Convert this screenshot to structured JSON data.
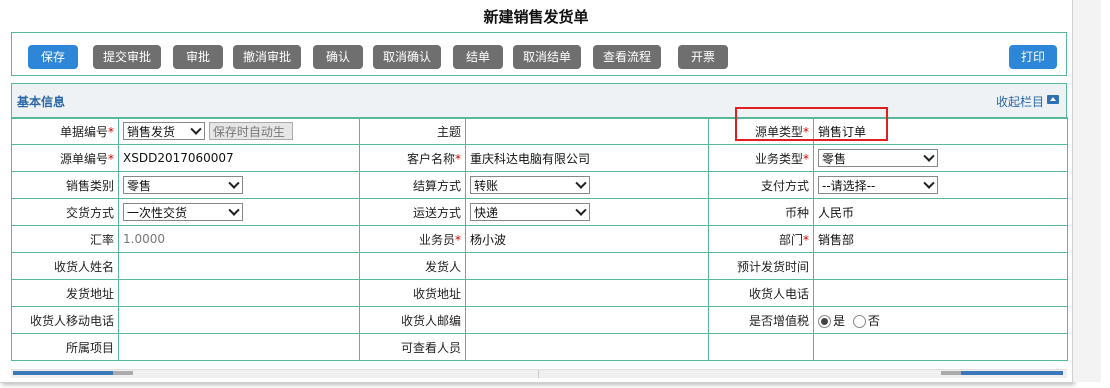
{
  "page": {
    "title": "新建销售发货单"
  },
  "toolbar": {
    "save": "保存",
    "submit": "提交审批",
    "approve": "审批",
    "revoke": "撤消审批",
    "confirm": "确认",
    "cancel_confirm": "取消确认",
    "close": "结单",
    "cancel_close": "取消结单",
    "view_flow": "查看流程",
    "invoice": "开票",
    "print": "打印"
  },
  "section": {
    "title": "基本信息",
    "collapse": "收起栏目"
  },
  "form": {
    "doc_no": {
      "label": "单据编号",
      "select": "销售发货",
      "placeholder": "保存时自动生"
    },
    "subject": {
      "label": "主题",
      "value": ""
    },
    "source_type": {
      "label": "源单类型",
      "value": "销售订单"
    },
    "source_no": {
      "label": "源单编号",
      "value": "XSDD2017060007"
    },
    "customer": {
      "label": "客户名称",
      "value": "重庆科达电脑有限公司"
    },
    "biz_type": {
      "label": "业务类型",
      "value": "零售"
    },
    "sales_category": {
      "label": "销售类别",
      "value": "零售"
    },
    "settlement": {
      "label": "结算方式",
      "value": "转账"
    },
    "payment": {
      "label": "支付方式",
      "value": "--请选择--"
    },
    "trade_mode": {
      "label": "交货方式",
      "value": "一次性交货"
    },
    "shipping": {
      "label": "运送方式",
      "value": "快递"
    },
    "currency": {
      "label": "币种",
      "value": "人民币"
    },
    "rate": {
      "label": "汇率",
      "value": "1.0000"
    },
    "salesman": {
      "label": "业务员",
      "value": "杨小波"
    },
    "dept": {
      "label": "部门",
      "value": "销售部"
    },
    "receiver_name": {
      "label": "收货人姓名"
    },
    "shipper": {
      "label": "发货人"
    },
    "eta": {
      "label": "预计发货时间"
    },
    "ship_addr": {
      "label": "发货地址"
    },
    "recv_addr": {
      "label": "收货地址"
    },
    "receiver_phone": {
      "label": "收货人电话"
    },
    "receiver_mobile": {
      "label": "收货人移动电话"
    },
    "receiver_zip": {
      "label": "收货人邮编"
    },
    "vat": {
      "label": "是否增值税",
      "yes": "是",
      "no": "否"
    },
    "project": {
      "label": "所属项目"
    },
    "viewers": {
      "label": "可查看人员"
    }
  }
}
